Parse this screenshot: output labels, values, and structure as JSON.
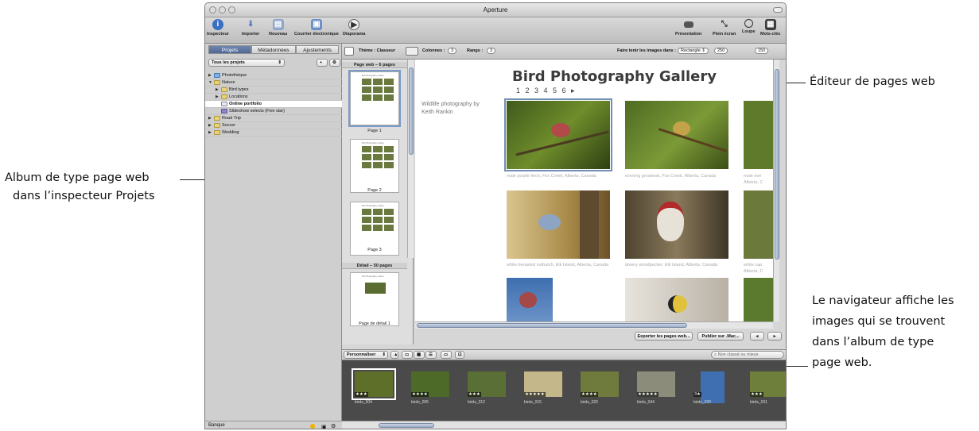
{
  "callouts": {
    "right_top": "Éditeur de pages web",
    "left_line1": "Album de type page web",
    "left_line2": "dans l’inspecteur Projets",
    "right_bottom_line1": "Le navigateur affiche les",
    "right_bottom_line2": "images qui se trouvent",
    "right_bottom_line3": "dans l’album de type",
    "right_bottom_line4": "page web."
  },
  "window": {
    "title": "Aperture"
  },
  "toolbar": {
    "inspector": "Inspecteur",
    "import": "Importer",
    "new": "Nouveau",
    "email": "Courrier électronique",
    "slideshow": "Diaporama",
    "presentation": "Présentation",
    "fullscreen": "Plein écran",
    "loupe": "Loupe",
    "keywords": "Mots-clés"
  },
  "inspector": {
    "tabs": [
      "Projets",
      "Métadonnées",
      "Ajustements"
    ],
    "filter": "Tous les projets",
    "tree": [
      {
        "label": "Photothèque",
        "indent": 0,
        "icon": "library"
      },
      {
        "label": "Nature",
        "indent": 0,
        "icon": "folder"
      },
      {
        "label": "Bird types",
        "indent": 1,
        "icon": "folder"
      },
      {
        "label": "Locations",
        "indent": 1,
        "icon": "folder"
      },
      {
        "label": "Online portfolio",
        "indent": 1,
        "icon": "web"
      },
      {
        "label": "Slideshow selects (Five star)",
        "indent": 1,
        "icon": "smart"
      },
      {
        "label": "Road Trip",
        "indent": 0,
        "icon": "folder"
      },
      {
        "label": "Soccer",
        "indent": 0,
        "icon": "folder"
      },
      {
        "label": "Wedding",
        "indent": 0,
        "icon": "folder"
      }
    ],
    "status": "Banque"
  },
  "editor_bar": {
    "theme": "Thème : Classeur",
    "columns_label": "Colonnes :",
    "columns_value": "3",
    "rows_label": "Rangs :",
    "rows_value": "3",
    "fit_label": "Faire tenir les images dans :",
    "fit_value": "Rectangle",
    "width_value": "250",
    "height_value": "150"
  },
  "pages": {
    "web_header": "Page web – 6 pages",
    "page1": "Page 1",
    "page2": "Page 2",
    "page3": "Page 3",
    "detail_header": "Détail – 50 pages",
    "detail_page": "Page de détail 1",
    "thumb_title": "Bird Photography Gallery"
  },
  "webpage": {
    "title": "Bird Photography Gallery",
    "page_links": "1 2 3 4 5 6 ▸",
    "byline": "Wildlife photography by Keith Rankin",
    "captions": [
      "male purple finch, Fox Creek, Alberta, Canada",
      "evening grosbeak, Fox Creek, Alberta, Canada",
      "male eve Alberta, C",
      "white-breasted nuthatch, Elk Island, Alberta, Canada",
      "downy woodpecker, Elk Island, Alberta, Canada",
      "white cap Alberta, C"
    ]
  },
  "export_bar": {
    "export_button": "Exporter les pages web...",
    "publish_button": "Publier sur .Mac..."
  },
  "browser": {
    "customize": "Personnaliser",
    "search_placeholder": "Non classé ou mieux",
    "items": [
      {
        "name": "birds_004",
        "stars": "★★★"
      },
      {
        "name": "birds_005",
        "stars": "★★★★"
      },
      {
        "name": "birds_012",
        "stars": "★★★"
      },
      {
        "name": "birds_015",
        "stars": "★★★★★"
      },
      {
        "name": "birds_020",
        "stars": "★★★★"
      },
      {
        "name": "birds_044",
        "stars": "★★★★★"
      },
      {
        "name": "birds_030",
        "stars": "3★"
      },
      {
        "name": "birds_031",
        "stars": "★★★"
      }
    ]
  }
}
